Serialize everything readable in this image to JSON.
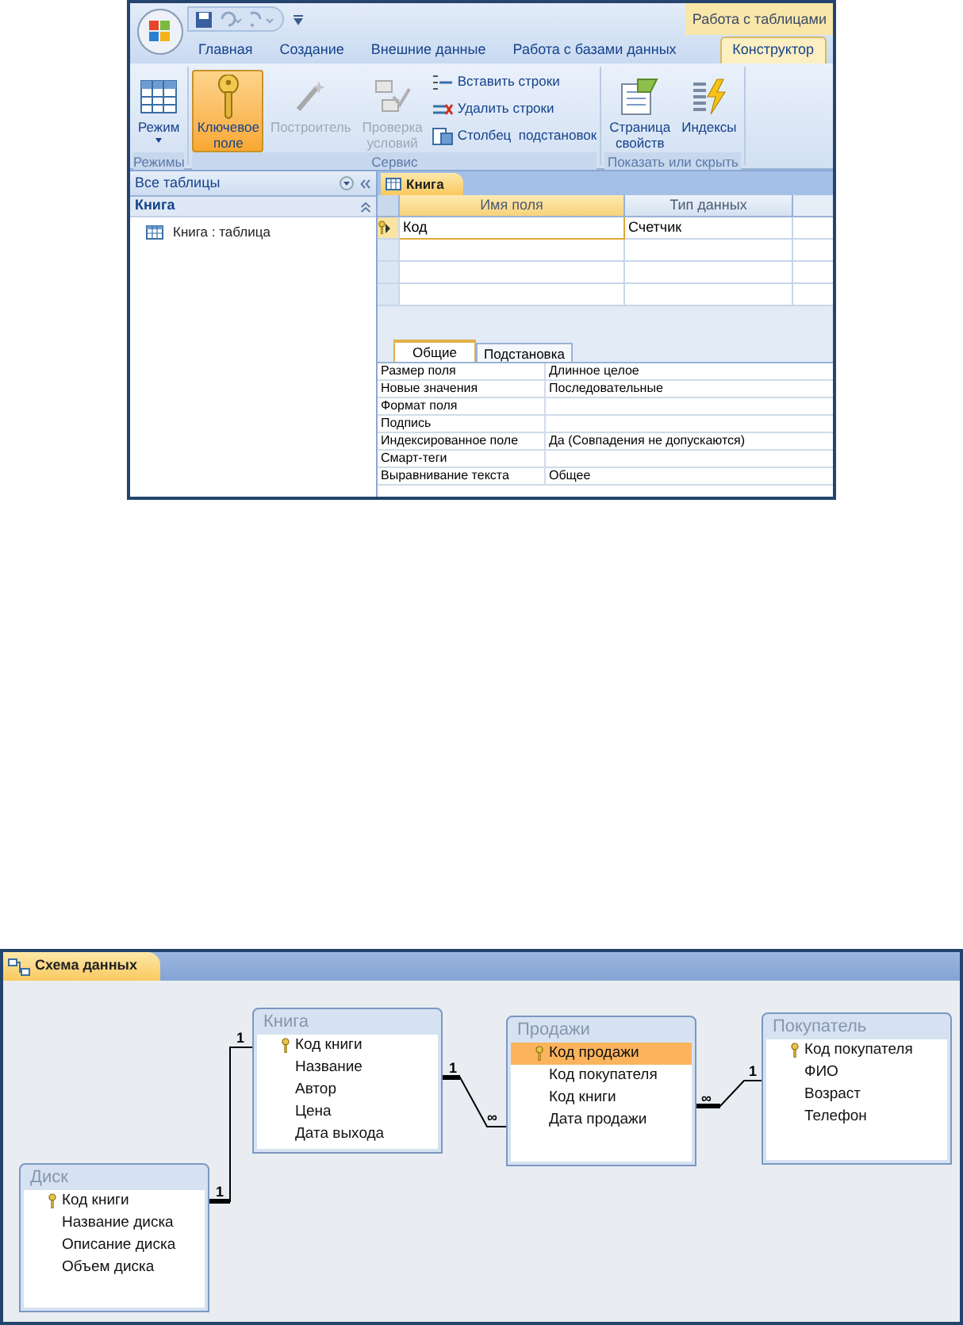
{
  "access_designer": {
    "contextual_tab": "Работа с таблицами",
    "ribbon_tabs": [
      {
        "label": "Главная",
        "selected": false
      },
      {
        "label": "Создание",
        "selected": false
      },
      {
        "label": "Внешние данные",
        "selected": false
      },
      {
        "label": "Работа с базами данных",
        "selected": false
      },
      {
        "label": "Конструктор",
        "selected": true
      }
    ],
    "ribbon_groups": [
      {
        "label": "Режимы",
        "buttons": [
          {
            "label": "Режим",
            "kind": "large",
            "dropdown": true,
            "selected": false,
            "disabled": false
          }
        ]
      },
      {
        "label": "Сервис",
        "buttons": [
          {
            "label": "Ключевое поле",
            "kind": "large",
            "selected": true,
            "disabled": false
          },
          {
            "label": "Построитель",
            "kind": "large",
            "selected": false,
            "disabled": true
          },
          {
            "label": "Проверка условий",
            "kind": "large",
            "selected": false,
            "disabled": true
          },
          {
            "label": "Вставить строки",
            "kind": "small",
            "selected": false,
            "disabled": false
          },
          {
            "label": "Удалить строки",
            "kind": "small",
            "selected": false,
            "disabled": false
          },
          {
            "label": "Столбец  подстановок",
            "kind": "small",
            "selected": false,
            "disabled": false
          }
        ]
      },
      {
        "label": "Показать или скрыть",
        "buttons": [
          {
            "label": "Страница свойств",
            "kind": "large",
            "selected": false,
            "disabled": false
          },
          {
            "label": "Индексы",
            "kind": "large",
            "selected": false,
            "disabled": false
          }
        ]
      }
    ],
    "navigation": {
      "header": "Все таблицы",
      "group": "Книга",
      "items": [
        "Книга : таблица"
      ]
    },
    "document_tab": "Книга",
    "grid": {
      "columns": [
        "Имя поля",
        "Тип данных"
      ],
      "rows": [
        {
          "name": "Код",
          "type": "Счетчик",
          "primary_key": true,
          "selected": true
        }
      ]
    },
    "property_tabs": [
      {
        "label": "Общие",
        "selected": true
      },
      {
        "label": "Подстановка",
        "selected": false
      }
    ],
    "properties": [
      {
        "label": "Размер поля",
        "value": "Длинное целое"
      },
      {
        "label": "Новые значения",
        "value": "Последовательные"
      },
      {
        "label": "Формат поля"
      },
      {
        "label": "Подпись"
      },
      {
        "label": "Индексированное поле",
        "value": "Да (Совпадения не допускаются)"
      },
      {
        "label": "Смарт-теги"
      },
      {
        "label": "Выравнивание текста",
        "value": "Общее"
      }
    ]
  },
  "relationship_diagram": {
    "tab": "Схема данных",
    "tables": [
      {
        "title": "Книга",
        "fields": [
          {
            "name": "Код книги",
            "primary_key": true,
            "selected": false
          },
          {
            "name": "Название",
            "primary_key": false,
            "selected": false
          },
          {
            "name": "Автор",
            "primary_key": false,
            "selected": false
          },
          {
            "name": "Цена",
            "primary_key": false,
            "selected": false
          },
          {
            "name": "Дата выхода",
            "primary_key": false,
            "selected": false
          }
        ]
      },
      {
        "title": "Продажи",
        "fields": [
          {
            "name": "Код продажи",
            "primary_key": true,
            "selected": true
          },
          {
            "name": "Код покупателя",
            "primary_key": false,
            "selected": false
          },
          {
            "name": "Код книги",
            "primary_key": false,
            "selected": false
          },
          {
            "name": "Дата продажи",
            "primary_key": false,
            "selected": false
          }
        ]
      },
      {
        "title": "Покупатель",
        "fields": [
          {
            "name": "Код покупателя",
            "primary_key": true,
            "selected": false
          },
          {
            "name": "ФИО",
            "primary_key": false,
            "selected": false
          },
          {
            "name": "Возраст",
            "primary_key": false,
            "selected": false
          },
          {
            "name": "Телефон",
            "primary_key": false,
            "selected": false
          }
        ]
      },
      {
        "title": "Диск",
        "fields": [
          {
            "name": "Код книги",
            "primary_key": true,
            "selected": false
          },
          {
            "name": "Название диска",
            "primary_key": false,
            "selected": false
          },
          {
            "name": "Описание диска",
            "primary_key": false,
            "selected": false
          },
          {
            "name": "Объем диска",
            "primary_key": false,
            "selected": false
          }
        ]
      }
    ],
    "relations": [
      {
        "start_label": "1",
        "end_label": "1"
      },
      {
        "start_label": "1",
        "end_label": "∞"
      },
      {
        "start_label": "∞",
        "end_label": "1"
      }
    ]
  }
}
